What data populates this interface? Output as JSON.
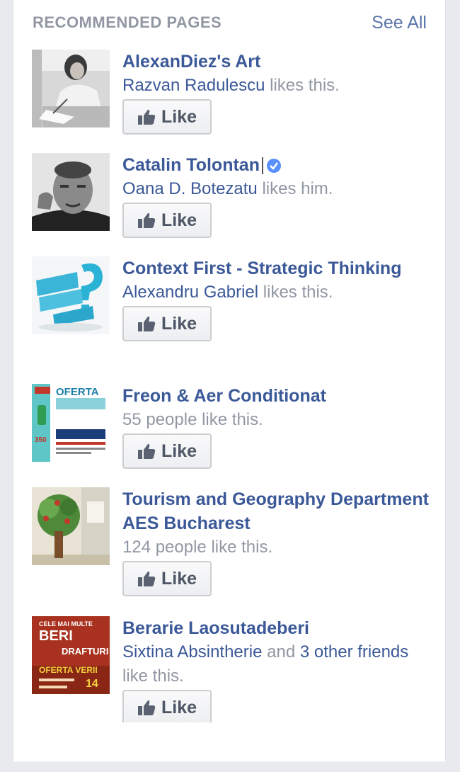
{
  "header": {
    "title": "RECOMMENDED PAGES",
    "see_all": "See All"
  },
  "like_label": "Like",
  "pages": [
    {
      "name": "AlexanDiez's Art",
      "friend": "Razvan Radulescu",
      "tail": " likes this.",
      "thumb_icon": "artist-drawing-photo"
    },
    {
      "name": "Catalin Tolontan",
      "verified": true,
      "friend": "Oana D. Botezatu",
      "tail": " likes him.",
      "thumb_icon": "man-portrait-photo"
    },
    {
      "name": "Context First - Strategic Thinking",
      "friend": "Alexandru Gabriel",
      "tail": " likes this.",
      "thumb_icon": "whats-your-plan-graphic"
    },
    {
      "name": "Freon & Aer Conditionat",
      "text": "55 people like this.",
      "thumb_icon": "oferta-flyer",
      "thumb_text": {
        "title": "OFERTA",
        "price": "350"
      }
    },
    {
      "name": "Tourism and Geography Department AES Bucharest",
      "text": "124 people like this.",
      "thumb_icon": "tree-wall-photo"
    },
    {
      "name": "Berarie Laosutadeberi",
      "friend": "Sixtina Absintherie",
      "mid": " and ",
      "friend2": "3 other friends",
      "tail": " like this.",
      "thumb_icon": "beer-offer-poster",
      "thumb_text": {
        "l1": "CELE MAI MULTE",
        "l2": "BERI",
        "l3": "DRAFTURI",
        "l4": "OFERTA VERII",
        "price": "14"
      }
    }
  ],
  "colors": {
    "link": "#3b5998",
    "muted": "#9197a3",
    "button_text": "#4e5665",
    "background": "#e9eaed"
  }
}
